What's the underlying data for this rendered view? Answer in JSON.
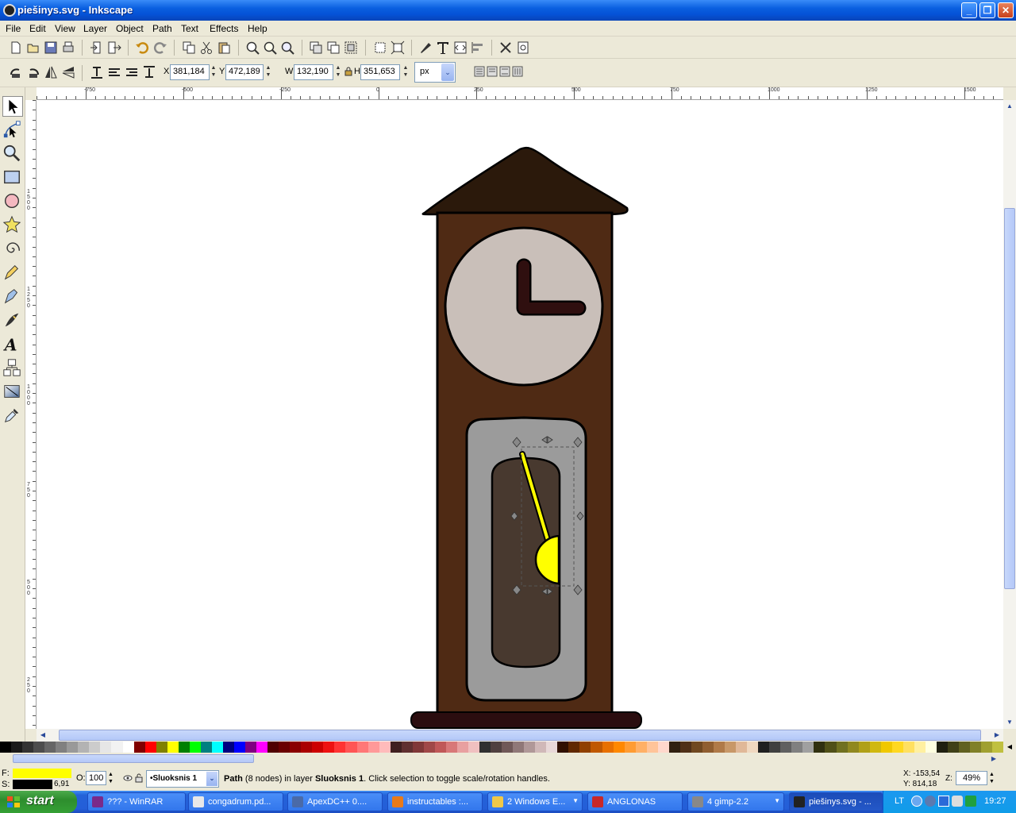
{
  "window": {
    "title": "piešinys.svg - Inkscape",
    "buttons": {
      "minimize": "_",
      "maximize": "❐",
      "close": "✕"
    }
  },
  "menu": {
    "items": [
      {
        "label": "File",
        "accel": "F"
      },
      {
        "label": "Edit",
        "accel": "E"
      },
      {
        "label": "View",
        "accel": "V"
      },
      {
        "label": "Layer",
        "accel": "L"
      },
      {
        "label": "Object",
        "accel": "O"
      },
      {
        "label": "Path",
        "accel": "P"
      },
      {
        "label": "Text",
        "accel": "T"
      },
      {
        "label": "Effects",
        "accel": "E"
      },
      {
        "label": "Help",
        "accel": "H"
      }
    ]
  },
  "toolbar": {
    "command_icons": [
      "new-document-icon",
      "open-icon",
      "save-icon",
      "print-icon",
      "import-icon",
      "export-icon",
      "undo-icon",
      "redo-icon",
      "duplicate-icon",
      "cut-icon",
      "paste-icon",
      "zoom-selection-icon",
      "zoom-drawing-icon",
      "zoom-page-icon",
      "clone-icon",
      "unlink-clone-icon",
      "group-icon",
      "ungroup-icon",
      "fill-stroke-icon",
      "text-font-icon",
      "xml-editor-icon",
      "align-icon",
      "preferences-icon",
      "document-properties-icon"
    ]
  },
  "selection": {
    "x_label": "X",
    "x_value": "381,184",
    "y_label": "Y",
    "y_value": "472,189",
    "w_label": "W",
    "w_value": "132,190",
    "h_label": "H",
    "h_value": "351,653",
    "unit": "px",
    "unit_arrow": "⌄"
  },
  "rulers": {
    "top_labels": [
      "-750",
      "-500",
      "-250",
      "0",
      "250",
      "500",
      "750",
      "1000",
      "1250",
      "1500"
    ],
    "left_labels": [
      "1500",
      "1250",
      "1000",
      "750",
      "500",
      "250"
    ]
  },
  "status": {
    "fill_label": "F:",
    "stroke_label": "S:",
    "fill_color": "#ffff00",
    "stroke_color": "#000000",
    "stroke_width": "6,91",
    "opacity_label": "O:",
    "opacity_value": "100",
    "layer_name": "•Sluoksnis 1",
    "message_object": "Path",
    "message_nodes": " (8 nodes) in layer ",
    "message_layer": "Sluoksnis 1",
    "message_tail": ". Click selection to toggle scale/rotation handles.",
    "cursor_x": "X: -153,54",
    "cursor_y": "Y: 814,18",
    "zoom_label": "Z:",
    "zoom_value": "49%"
  },
  "taskbar": {
    "start_label": "start",
    "tasks": [
      {
        "label": "??? - WinRAR",
        "color": "#7a2a8a"
      },
      {
        "label": "congadrum.pd...",
        "color": "#e8e8e8"
      },
      {
        "label": "ApexDC++ 0....",
        "color": "#4a6aa8"
      },
      {
        "label": "instructables :...",
        "color": "#e87a1a"
      },
      {
        "label": "2 Windows E...",
        "color": "#f0c848"
      },
      {
        "label": "ANGLONAS",
        "color": "#c82828"
      },
      {
        "label": "4 gimp-2.2",
        "color": "#888888"
      },
      {
        "label": "piešinys.svg - ...",
        "color": "#222222"
      }
    ],
    "tray_lang": "LT",
    "clock": "19:27"
  },
  "colors": {
    "roof": "#2b190b",
    "case": "#4f2a14",
    "clock_face": "#c9bfb9",
    "hands": "#2f0f0f",
    "pendulum_frame": "#9b9b9b",
    "pendulum_window": "#48392f",
    "pendulum": "#ffff00",
    "base": "#2b0d0f"
  }
}
